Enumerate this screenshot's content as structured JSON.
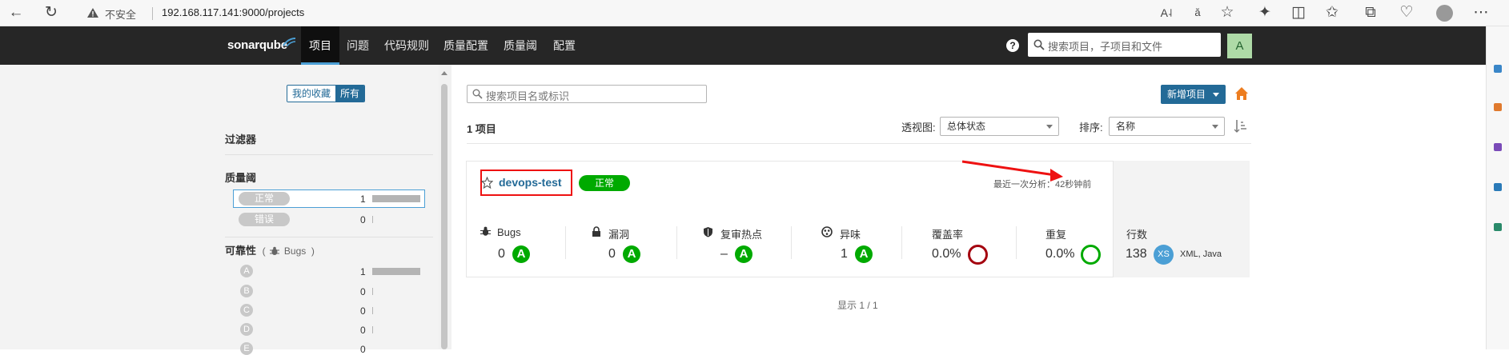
{
  "browser": {
    "security": "不安全",
    "url": "192.168.117.141:9000/projects"
  },
  "header": {
    "logo": "sonarqube",
    "nav": [
      "项目",
      "问题",
      "代码规则",
      "质量配置",
      "质量阈",
      "配置"
    ],
    "help": "?",
    "search_placeholder": "搜索项目，子项目和文件",
    "avatar": "A"
  },
  "sidebar": {
    "toggle": {
      "favorites": "我的收藏",
      "all": "所有"
    },
    "filters_title": "过滤器",
    "quality_gate": {
      "title": "质量阈",
      "items": [
        {
          "label": "正常",
          "count": "1",
          "fraction": 1.0
        },
        {
          "label": "错误",
          "count": "0",
          "fraction": 0.0
        }
      ]
    },
    "reliability": {
      "title": "可靠性",
      "subtitle": "Bugs",
      "paren_open": "(",
      "paren_close": ")",
      "items": [
        {
          "grade": "A",
          "count": "1",
          "fraction": 1.0
        },
        {
          "grade": "B",
          "count": "0",
          "fraction": 0.0
        },
        {
          "grade": "C",
          "count": "0",
          "fraction": 0.0
        },
        {
          "grade": "D",
          "count": "0",
          "fraction": 0.0
        },
        {
          "grade": "E",
          "count": "0",
          "fraction": 0.0
        }
      ]
    }
  },
  "main": {
    "search_placeholder": "搜索项目名或标识",
    "new_project": "新增项目",
    "project_count": "1 项目",
    "perspective_label": "透视图:",
    "perspective_value": "总体状态",
    "sort_label": "排序:",
    "sort_value": "名称",
    "project": {
      "name": "devops-test",
      "gate": "正常",
      "last_analysis": "最近一次分析：42秒钟前",
      "metrics": [
        {
          "label": "Bugs",
          "value": "0",
          "rating": "A"
        },
        {
          "label": "漏洞",
          "value": "0",
          "rating": "A"
        },
        {
          "label": "复审热点",
          "value": "–",
          "rating": "A"
        },
        {
          "label": "异味",
          "value": "1",
          "rating": "A"
        },
        {
          "label": "覆盖率",
          "value": "0.0%"
        },
        {
          "label": "重复",
          "value": "0.0%"
        }
      ],
      "lines_label": "行数",
      "lines_value": "138",
      "size": "XS",
      "languages": "XML, Java"
    },
    "pagination": "显示 1 / 1"
  },
  "colors": {
    "header_bg": "#262626",
    "accent": "#236a97",
    "rating_a": "#00aa00",
    "coverage_ring": "#a4030f",
    "duplication_ring": "#00aa00",
    "annotation_red": "#ee1111"
  }
}
